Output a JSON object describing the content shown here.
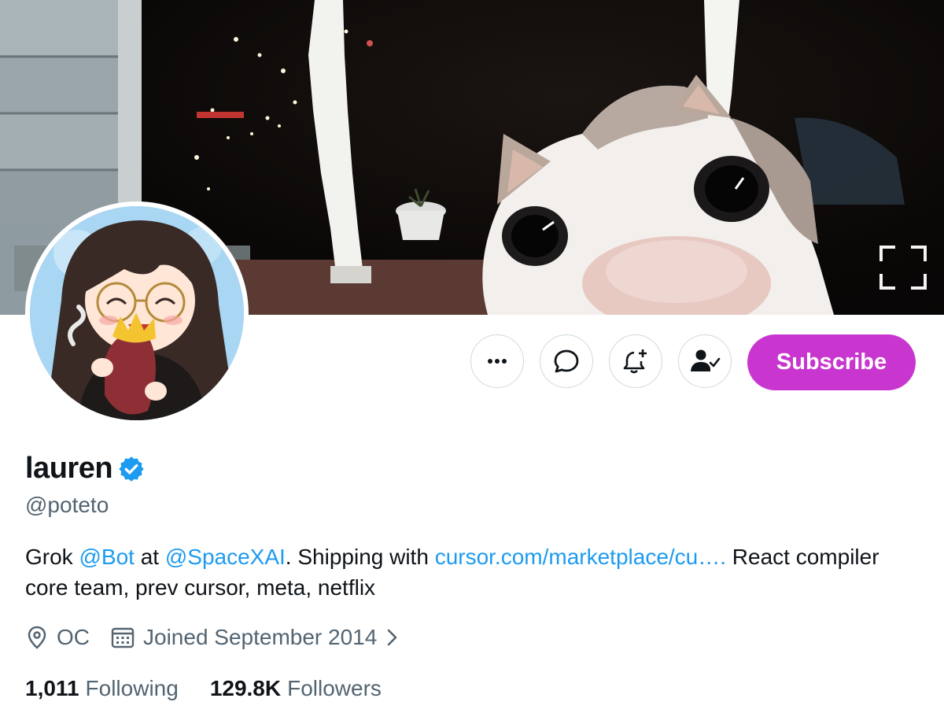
{
  "profile": {
    "display_name": "lauren",
    "handle": "@poteto",
    "bio": {
      "p1": "Grok ",
      "mention1": "@Bot",
      "p2": " at ",
      "mention2": "@SpaceXAI",
      "p3": ". Shipping with ",
      "url": "cursor.com/marketplace/cu….",
      "p4": " React compiler core team, prev cursor, meta, netflix"
    },
    "location": "OC",
    "joined": "Joined September 2014"
  },
  "stats": {
    "following_count": "1,011",
    "following_label": "Following",
    "followers_count": "129.8K",
    "followers_label": "Followers"
  },
  "actions": {
    "subscribe_label": "Subscribe",
    "icons": [
      "more-icon",
      "message-icon",
      "notification-bell-icon",
      "following-user-icon"
    ]
  },
  "colors": {
    "accent_subscribe": "#c936cf",
    "link": "#1d9bf0",
    "verified_badge": "#1d9bf0",
    "secondary_text": "#536471",
    "primary_text": "#0f1419",
    "button_border": "#cfd9de"
  }
}
